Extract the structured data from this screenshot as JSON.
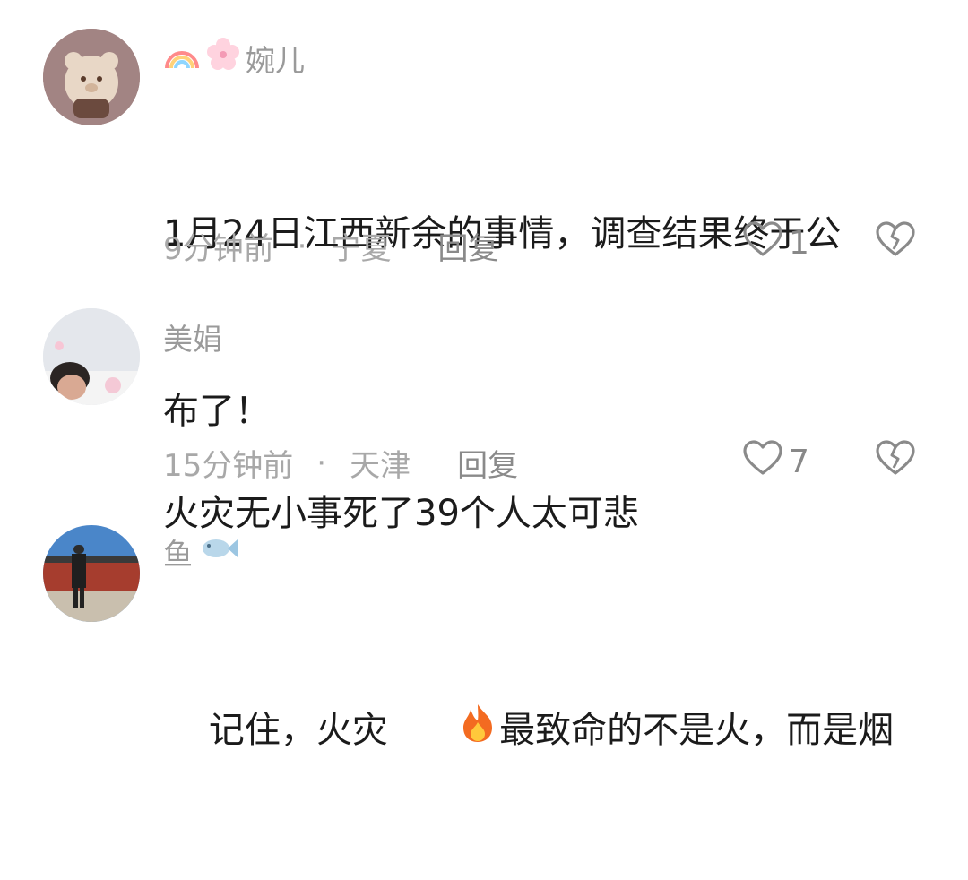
{
  "comments": [
    {
      "username": "婉儿",
      "username_icons": [
        "rainbow-icon",
        "cherry-blossom-icon"
      ],
      "text": "1月24日江西新余的事情，调查结果终于公布了！",
      "line1": "1月24日江西新余的事情，调查结果终于公",
      "line2": "布了！",
      "time": "9分钟前",
      "location": "宁夏",
      "reply_label": "回复",
      "likes": "1"
    },
    {
      "username": "美娟",
      "text": "火灾无小事死了39个人太可悲",
      "time": "15分钟前",
      "location": "天津",
      "reply_label": "回复",
      "likes": "7"
    },
    {
      "username": "鱼",
      "username_icons": [
        "fish-icon"
      ],
      "text_before_emoji": "记住，火灾",
      "emoji": "fire-icon",
      "text_after_emoji": "最致命的不是火，而是烟"
    }
  ],
  "separator": "·",
  "colors": {
    "name": "#9a9a9a",
    "text": "#1b1b1b",
    "meta": "#a8a8a8",
    "icon": "#8a8a8a"
  }
}
